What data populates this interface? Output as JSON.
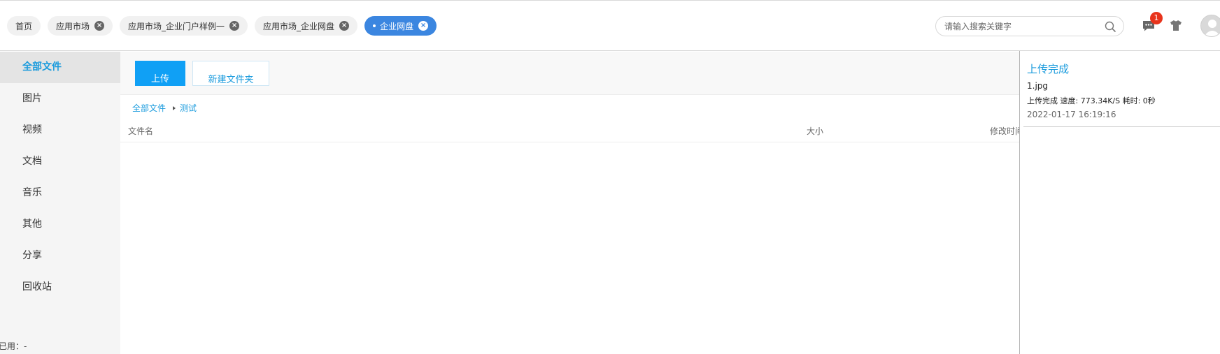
{
  "tabs": [
    {
      "label": "首页",
      "closable": false,
      "active": false
    },
    {
      "label": "应用市场",
      "closable": true,
      "active": false
    },
    {
      "label": "应用市场_企业门户样例一",
      "closable": true,
      "active": false
    },
    {
      "label": "应用市场_企业网盘",
      "closable": true,
      "active": false
    },
    {
      "label": "企业网盘",
      "closable": true,
      "active": true
    }
  ],
  "search": {
    "placeholder": "请输入搜索关键字",
    "value": ""
  },
  "notifications": {
    "count": "1"
  },
  "colors": {
    "accent": "#1a9bdd",
    "active_tab": "#3b86e0",
    "upload_button": "#10a0f5",
    "badge": "#e8341c"
  },
  "icons": {
    "search": "search-icon",
    "messages": "message-icon",
    "theme": "shirt-icon",
    "user": "avatar"
  },
  "sidebar": {
    "items": [
      {
        "label": "全部文件",
        "active": true
      },
      {
        "label": "图片"
      },
      {
        "label": "视频"
      },
      {
        "label": "文档"
      },
      {
        "label": "音乐"
      },
      {
        "label": "其他"
      },
      {
        "label": "分享"
      },
      {
        "label": "回收站"
      }
    ],
    "storage_label": "已用：-"
  },
  "toolbar": {
    "upload_label": "上传",
    "new_folder_label": "新建文件夹"
  },
  "breadcrumb": {
    "root": "全部文件",
    "current": "测试"
  },
  "table": {
    "columns": [
      "文件名",
      "大小",
      "修改时间"
    ]
  },
  "upload_panel": {
    "title": "上传完成",
    "file_name": "1.jpg",
    "status": "上传完成 速度: 773.34K/S 耗时: 0秒",
    "time": "2022-01-17 16:19:16"
  }
}
